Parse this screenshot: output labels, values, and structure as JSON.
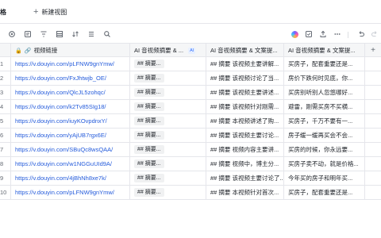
{
  "tabs": {
    "active_label": "格",
    "new_view_label": "新建视图"
  },
  "columns": [
    "视频链接",
    "AI 音视频摘要 & ...",
    "AI 音视频摘要 & 文案提...",
    "AI 音视频摘要 & 文案提..."
  ],
  "ai_badge": "AI",
  "rows": [
    {
      "num": "1",
      "link": "https://v.douyin.com/pLFNW9gnYmw/",
      "summary": "## 摘要...",
      "desc": "## 摘要 该视频主要讲解...",
      "text": "买房子，配套重要还是..."
    },
    {
      "num": "2",
      "link": "https://v.douyin.com/FxJhtwjb_OE/",
      "summary": "## 摘要...",
      "desc": "## 摘要 该视频讨论了当...",
      "text": "房价下跌何时见底，你..."
    },
    {
      "num": "3",
      "link": "https://v.douyin.com/QlcJL5zohqc/",
      "summary": "## 摘要...",
      "desc": "## 摘要 该视频主要讲述...",
      "text": "买房别听别人忽悠哪好..."
    },
    {
      "num": "4",
      "link": "https://v.douyin.com/k2Tv85SIg18/",
      "summary": "## 摘要...",
      "desc": "## 摘要 该视频针对刚需...",
      "text": "避雷，刚需买房不买横..."
    },
    {
      "num": "5",
      "link": "https://v.douyin.com/iuyKOvpdnxY/",
      "summary": "## 摘要...",
      "desc": "## 摘要 本视频讲述了购...",
      "text": "买房子，千万不要有一..."
    },
    {
      "num": "6",
      "link": "https://v.douyin.com/yAjUB7rgx6E/",
      "summary": "## 摘要...",
      "desc": "## 摘要 该视频主要讨论...",
      "text": "房子缓一缓再买会不会..."
    },
    {
      "num": "7",
      "link": "https://v.douyin.com/SBuQc8wsQAA/",
      "summary": "## 摘要...",
      "desc": "## 摘要 视频内容主要讲...",
      "text": "买房的时候，你永远要..."
    },
    {
      "num": "8",
      "link": "https://v.douyin.com/w1NGGuUId9A/",
      "summary": "## 摘要...",
      "desc": "## 摘要 视频中，博主分...",
      "text": "买房子卖不动，就是价格..."
    },
    {
      "num": "9",
      "link": "https://v.douyin.com/4jBhNh8xe7k/",
      "summary": "## 摘要...",
      "desc": "## 摘要 该视频主要讨论了...",
      "text": "今年买的房子和明年买..."
    },
    {
      "num": "10",
      "link": "https://v.douyin.com/pLFNW9gnYmw/",
      "summary": "## 摘要...",
      "desc": "## 摘要 本视频针对首次...",
      "text": "买房子，配套重要还是..."
    }
  ]
}
